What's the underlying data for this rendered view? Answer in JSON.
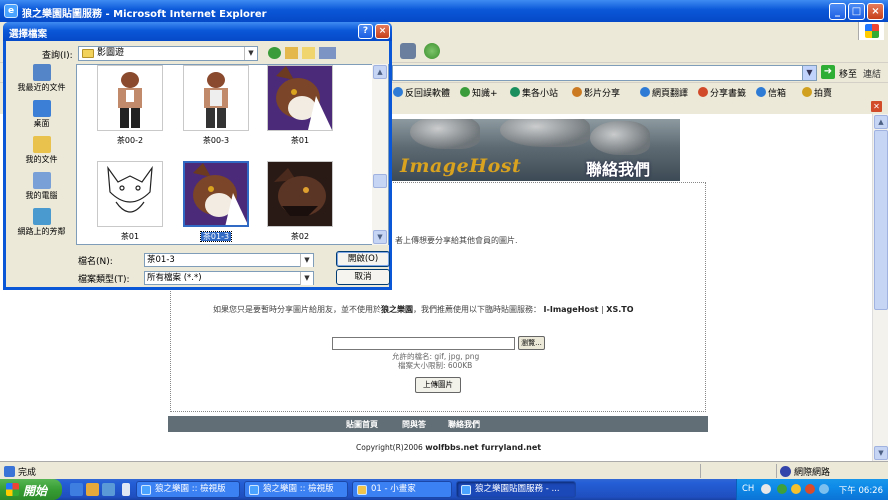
{
  "ie": {
    "title": "狼之樂園貼圖服務 - Microsoft Internet Explorer",
    "address_go": "移至",
    "address_links": "連結",
    "links_bar": [
      {
        "label": "反回誤軟體",
        "color": "#2e7bd6"
      },
      {
        "label": "知識+",
        "color": "#3a9c3a"
      },
      {
        "label": "集各小站",
        "color": "#1c8f5e"
      },
      {
        "label": "影片分享",
        "color": "#cc7a22"
      },
      {
        "label": "網頁翻譯",
        "color": "#2e7bd6"
      },
      {
        "label": "分享書籤",
        "color": "#d14a2a"
      },
      {
        "label": "信箱",
        "color": "#2e7bd6"
      },
      {
        "label": "拍賣",
        "color": "#d0a01e"
      }
    ],
    "status_done": "完成",
    "status_zone": "網際網路"
  },
  "page": {
    "banner_brand": "ImageHost",
    "banner_contact": "聯絡我們",
    "intro_text": "者上傳想要分享給其他會員的圖片.",
    "notice_prefix": "如果您只是要暫時分享圖片給朋友，並不使用於",
    "notice_site": "狼之樂園",
    "notice_mid": "，我們推薦使用以下臨時貼圖服務：",
    "notice_link1": "I-ImageHost",
    "notice_sep": "|",
    "notice_link2": "XS.TO",
    "browse_label": "瀏覽...",
    "allowed_types": "允許的檔名: gif, jpg, png",
    "max_size": "檔案大小限制: 600KB",
    "upload_label": "上傳圖片",
    "footer_links": [
      "貼圖首頁",
      "問與答",
      "聯絡我們"
    ],
    "copyright_prefix": "Copyright(R)2006",
    "copyright_sites": "wolfbbs.net furryland.net"
  },
  "dialog": {
    "title": "選擇檔案",
    "look_in_label": "查詢(I):",
    "look_in_value": "影圖遊",
    "places": [
      "我最近的文件",
      "桌面",
      "我的文件",
      "我的電腦",
      "網路上的芳鄰"
    ],
    "files": [
      {
        "name": "茶00-2",
        "kind": "sketch-color",
        "selected": false
      },
      {
        "name": "茶00-3",
        "kind": "sketch-color",
        "selected": false
      },
      {
        "name": "茶01",
        "kind": "purple-wolf",
        "selected": false
      },
      {
        "name": "茶01",
        "kind": "lineart",
        "selected": false
      },
      {
        "name": "茶01-3",
        "kind": "purple-wolf",
        "selected": true
      },
      {
        "name": "茶02",
        "kind": "dark-wolf",
        "selected": false
      }
    ],
    "filename_label": "檔名(N):",
    "filename_value": "茶01-3",
    "filetype_label": "檔案類型(T):",
    "filetype_value": "所有檔案 (*.*)",
    "open_label": "開啟(O)",
    "cancel_label": "取消"
  },
  "taskbar": {
    "start_label": "開始",
    "tasks": [
      {
        "label": "狼之樂園 :: 檢視版",
        "active": false
      },
      {
        "label": "狼之樂園 :: 檢視版",
        "active": false
      },
      {
        "label": "01 - 小畫家",
        "active": false
      },
      {
        "label": "狼之樂園貼圖服務 - ...",
        "active": true
      }
    ],
    "lang": "CH",
    "clock": "下午 06:26"
  }
}
